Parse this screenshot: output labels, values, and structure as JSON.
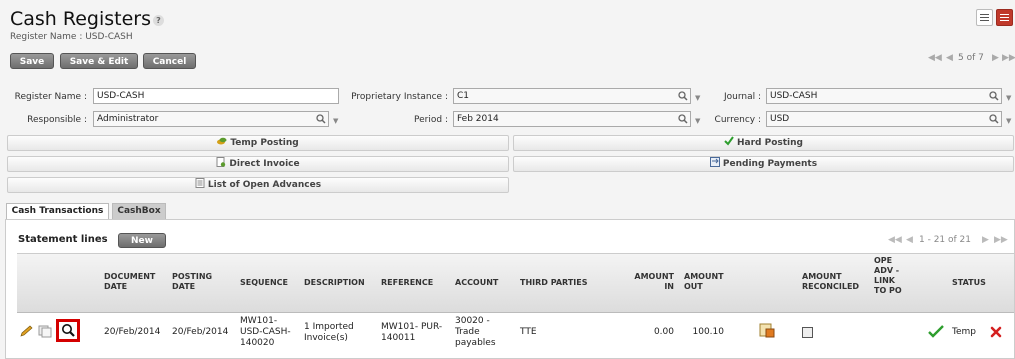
{
  "header": {
    "title": "Cash Registers",
    "help": "?",
    "subtitle": "Register Name : USD-CASH"
  },
  "toolbar": {
    "save_label": "Save",
    "save_edit_label": "Save & Edit",
    "cancel_label": "Cancel",
    "pager_text": "5 of 7"
  },
  "form": {
    "register_name_label": "Register Name :",
    "register_name_value": "USD-CASH",
    "prop_instance_label": "Proprietary Instance :",
    "prop_instance_value": "C1",
    "journal_label": "Journal :",
    "journal_value": "USD-CASH",
    "responsible_label": "Responsible :",
    "responsible_value": "Administrator",
    "period_label": "Period :",
    "period_value": "Feb 2014",
    "currency_label": "Currency :",
    "currency_value": "USD"
  },
  "actions": {
    "temp_posting": "Temp Posting",
    "hard_posting": "Hard Posting",
    "direct_invoice": "Direct Invoice",
    "pending_payments": "Pending Payments",
    "open_advances": "List of Open Advances"
  },
  "tabs": {
    "cash_transactions": "Cash Transactions",
    "cashbox": "CashBox"
  },
  "statement": {
    "title": "Statement lines",
    "new_label": "New",
    "pager_text": "1 - 21 of 21"
  },
  "table": {
    "headers": {
      "doc_date": "DOCUMENT DATE",
      "posting_date": "POSTING DATE",
      "sequence": "SEQUENCE",
      "description": "DESCRIPTION",
      "reference": "REFERENCE",
      "account": "ACCOUNT",
      "third_parties": "THIRD PARTIES",
      "amount_in": "AMOUNT IN",
      "amount_out": "AMOUNT OUT",
      "amount_reconciled": "AMOUNT RECONCILED",
      "ope_adv": "OPE ADV - LINK TO PO",
      "status": "STATUS"
    },
    "row": {
      "doc_date": "20/Feb/2014",
      "posting_date": "20/Feb/2014",
      "sequence": "MW101- USD-CASH- 140020",
      "description": "1 Imported Invoice(s)",
      "reference": "MW101- PUR-140011",
      "account": "30020 - Trade payables",
      "third_parties": "TTE",
      "amount_in": "0.00",
      "amount_out": "100.10",
      "status": "Temp"
    }
  },
  "colors": {
    "accent_red": "#c0392b",
    "highlight_red": "#d40000",
    "ok_green": "#2e9e2e"
  }
}
